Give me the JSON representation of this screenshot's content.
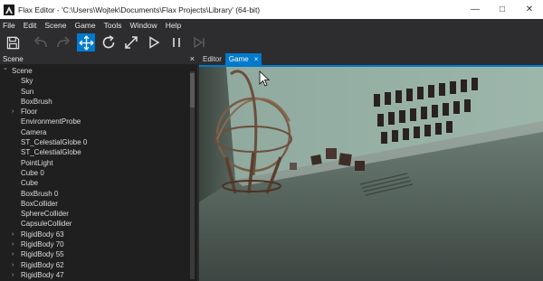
{
  "window": {
    "title": "Flax Editor - 'C:\\Users\\Wojtek\\Documents\\Flax Projects\\Library' (64-bit)",
    "controls": [
      "minimize-icon",
      "maximize-icon",
      "close-icon"
    ]
  },
  "menu": {
    "items": [
      "File",
      "Edit",
      "Scene",
      "Game",
      "Tools",
      "Window",
      "Help"
    ]
  },
  "toolbar": {
    "buttons": [
      "save-icon",
      "undo-icon",
      "redo-icon",
      "translate-gizmo-icon",
      "rotate-gizmo-icon",
      "scale-gizmo-icon",
      "play-icon",
      "pause-icon",
      "step-icon"
    ],
    "active": "translate-gizmo-icon",
    "accent": "#007acc"
  },
  "scene_panel": {
    "title": "Scene",
    "close": "×",
    "tree": [
      {
        "label": "Scene",
        "expanded": true
      },
      {
        "label": "Sky"
      },
      {
        "label": "Sun"
      },
      {
        "label": "BoxBrush"
      },
      {
        "label": "Floor",
        "has_children": true
      },
      {
        "label": "EnvironmentProbe"
      },
      {
        "label": "Camera"
      },
      {
        "label": "ST_CelestialGlobe 0"
      },
      {
        "label": "ST_CelestialGlobe"
      },
      {
        "label": "PointLight"
      },
      {
        "label": "Cube 0"
      },
      {
        "label": "Cube"
      },
      {
        "label": "BoxBrush 0"
      },
      {
        "label": "BoxCollider"
      },
      {
        "label": "SphereCollider"
      },
      {
        "label": "CapsuleCollider"
      },
      {
        "label": "RigidBody 63",
        "has_children": true
      },
      {
        "label": "RigidBody 70",
        "has_children": true
      },
      {
        "label": "RigidBody 55",
        "has_children": true
      },
      {
        "label": "RigidBody 62",
        "has_children": true
      },
      {
        "label": "RigidBody 47",
        "has_children": true
      }
    ]
  },
  "tabs": [
    {
      "label": "Editor",
      "active": false
    },
    {
      "label": "Game",
      "active": true,
      "close": "×"
    }
  ]
}
